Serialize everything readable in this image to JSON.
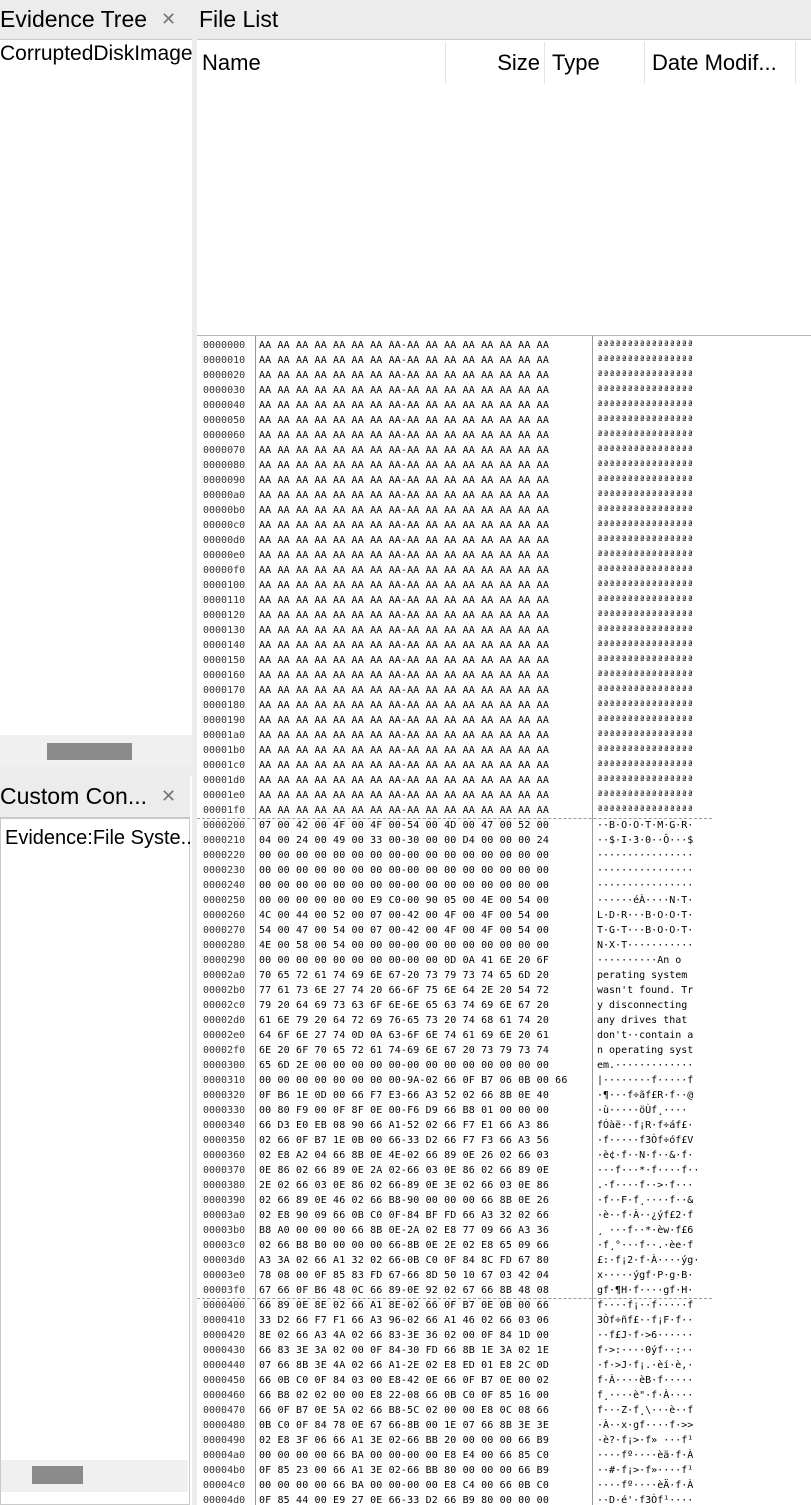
{
  "evidence_tree": {
    "title": "Evidence Tree",
    "items": [
      "CorruptedDiskImage"
    ]
  },
  "custom_content": {
    "title": "Custom Con...",
    "items": [
      "Evidence:File Syste..."
    ]
  },
  "file_list": {
    "title": "File List",
    "columns": [
      "Name",
      "Size",
      "Type",
      "Date Modif..."
    ]
  },
  "hex_view": {
    "rows": [
      [
        "0000000",
        "AA AA AA AA AA AA AA AA-AA AA AA AA AA AA AA AA",
        "ªªªªªªªªªªªªªªªª"
      ],
      [
        "0000010",
        "AA AA AA AA AA AA AA AA-AA AA AA AA AA AA AA AA",
        "ªªªªªªªªªªªªªªªª"
      ],
      [
        "0000020",
        "AA AA AA AA AA AA AA AA-AA AA AA AA AA AA AA AA",
        "ªªªªªªªªªªªªªªªª"
      ],
      [
        "0000030",
        "AA AA AA AA AA AA AA AA-AA AA AA AA AA AA AA AA",
        "ªªªªªªªªªªªªªªªª"
      ],
      [
        "0000040",
        "AA AA AA AA AA AA AA AA-AA AA AA AA AA AA AA AA",
        "ªªªªªªªªªªªªªªªª"
      ],
      [
        "0000050",
        "AA AA AA AA AA AA AA AA-AA AA AA AA AA AA AA AA",
        "ªªªªªªªªªªªªªªªª"
      ],
      [
        "0000060",
        "AA AA AA AA AA AA AA AA-AA AA AA AA AA AA AA AA",
        "ªªªªªªªªªªªªªªªª"
      ],
      [
        "0000070",
        "AA AA AA AA AA AA AA AA-AA AA AA AA AA AA AA AA",
        "ªªªªªªªªªªªªªªªª"
      ],
      [
        "0000080",
        "AA AA AA AA AA AA AA AA-AA AA AA AA AA AA AA AA",
        "ªªªªªªªªªªªªªªªª"
      ],
      [
        "0000090",
        "AA AA AA AA AA AA AA AA-AA AA AA AA AA AA AA AA",
        "ªªªªªªªªªªªªªªªª"
      ],
      [
        "00000a0",
        "AA AA AA AA AA AA AA AA-AA AA AA AA AA AA AA AA",
        "ªªªªªªªªªªªªªªªª"
      ],
      [
        "00000b0",
        "AA AA AA AA AA AA AA AA-AA AA AA AA AA AA AA AA",
        "ªªªªªªªªªªªªªªªª"
      ],
      [
        "00000c0",
        "AA AA AA AA AA AA AA AA-AA AA AA AA AA AA AA AA",
        "ªªªªªªªªªªªªªªªª"
      ],
      [
        "00000d0",
        "AA AA AA AA AA AA AA AA-AA AA AA AA AA AA AA AA",
        "ªªªªªªªªªªªªªªªª"
      ],
      [
        "00000e0",
        "AA AA AA AA AA AA AA AA-AA AA AA AA AA AA AA AA",
        "ªªªªªªªªªªªªªªªª"
      ],
      [
        "00000f0",
        "AA AA AA AA AA AA AA AA-AA AA AA AA AA AA AA AA",
        "ªªªªªªªªªªªªªªªª"
      ],
      [
        "0000100",
        "AA AA AA AA AA AA AA AA-AA AA AA AA AA AA AA AA",
        "ªªªªªªªªªªªªªªªª"
      ],
      [
        "0000110",
        "AA AA AA AA AA AA AA AA-AA AA AA AA AA AA AA AA",
        "ªªªªªªªªªªªªªªªª"
      ],
      [
        "0000120",
        "AA AA AA AA AA AA AA AA-AA AA AA AA AA AA AA AA",
        "ªªªªªªªªªªªªªªªª"
      ],
      [
        "0000130",
        "AA AA AA AA AA AA AA AA-AA AA AA AA AA AA AA AA",
        "ªªªªªªªªªªªªªªªª"
      ],
      [
        "0000140",
        "AA AA AA AA AA AA AA AA-AA AA AA AA AA AA AA AA",
        "ªªªªªªªªªªªªªªªª"
      ],
      [
        "0000150",
        "AA AA AA AA AA AA AA AA-AA AA AA AA AA AA AA AA",
        "ªªªªªªªªªªªªªªªª"
      ],
      [
        "0000160",
        "AA AA AA AA AA AA AA AA-AA AA AA AA AA AA AA AA",
        "ªªªªªªªªªªªªªªªª"
      ],
      [
        "0000170",
        "AA AA AA AA AA AA AA AA-AA AA AA AA AA AA AA AA",
        "ªªªªªªªªªªªªªªªª"
      ],
      [
        "0000180",
        "AA AA AA AA AA AA AA AA-AA AA AA AA AA AA AA AA",
        "ªªªªªªªªªªªªªªªª"
      ],
      [
        "0000190",
        "AA AA AA AA AA AA AA AA-AA AA AA AA AA AA AA AA",
        "ªªªªªªªªªªªªªªªª"
      ],
      [
        "00001a0",
        "AA AA AA AA AA AA AA AA-AA AA AA AA AA AA AA AA",
        "ªªªªªªªªªªªªªªªª"
      ],
      [
        "00001b0",
        "AA AA AA AA AA AA AA AA-AA AA AA AA AA AA AA AA",
        "ªªªªªªªªªªªªªªªª"
      ],
      [
        "00001c0",
        "AA AA AA AA AA AA AA AA-AA AA AA AA AA AA AA AA",
        "ªªªªªªªªªªªªªªªª"
      ],
      [
        "00001d0",
        "AA AA AA AA AA AA AA AA-AA AA AA AA AA AA AA AA",
        "ªªªªªªªªªªªªªªªª"
      ],
      [
        "00001e0",
        "AA AA AA AA AA AA AA AA-AA AA AA AA AA AA AA AA",
        "ªªªªªªªªªªªªªªªª"
      ],
      [
        "00001f0",
        "AA AA AA AA AA AA AA AA-AA AA AA AA AA AA AA AA",
        "ªªªªªªªªªªªªªªªª"
      ],
      [
        "0000200",
        "07 00 42 00 4F 00 4F 00-54 00 4D 00 47 00 52 00",
        "··B·O·O·T·M·G·R·"
      ],
      [
        "0000210",
        "04 00 24 00 49 00 33 00-30 00 00 D4 00 00 00 24",
        "··$·I·3·0··Ô···$"
      ],
      [
        "0000220",
        "00 00 00 00 00 00 00 00-00 00 00 00 00 00 00 00",
        "················"
      ],
      [
        "0000230",
        "00 00 00 00 00 00 00 00-00 00 00 00 00 00 00 00",
        "················"
      ],
      [
        "0000240",
        "00 00 00 00 00 00 00 00-00 00 00 00 00 00 00 00",
        "················"
      ],
      [
        "0000250",
        "00 00 00 00 00 00 E9 C0-00 90 05 00 4E 00 54 00",
        "······éÀ····N·T·"
      ],
      [
        "0000260",
        "4C 00 44 00 52 00 07 00-42 00 4F 00 4F 00 54 00",
        "L·D·R···B·O·O·T·"
      ],
      [
        "0000270",
        "54 00 47 00 54 00 07 00-42 00 4F 00 4F 00 54 00",
        "T·G·T···B·O·O·T·"
      ],
      [
        "0000280",
        "4E 00 58 00 54 00 00 00-00 00 00 00 00 00 00 00",
        "N·X·T···········"
      ],
      [
        "0000290",
        "00 00 00 00 00 00 00 00-00 00 0D 0A 41 6E 20 6F",
        "··········An o"
      ],
      [
        "00002a0",
        "70 65 72 61 74 69 6E 67-20 73 79 73 74 65 6D 20",
        "perating system "
      ],
      [
        "00002b0",
        "77 61 73 6E 27 74 20 66-6F 75 6E 64 2E 20 54 72",
        "wasn't found. Tr"
      ],
      [
        "00002c0",
        "79 20 64 69 73 63 6F 6E-6E 65 63 74 69 6E 67 20",
        "y disconnecting "
      ],
      [
        "00002d0",
        "61 6E 79 20 64 72 69 76-65 73 20 74 68 61 74 20",
        "any drives that "
      ],
      [
        "00002e0",
        "64 6F 6E 27 74 0D 0A 63-6F 6E 74 61 69 6E 20 61",
        "don't··contain a"
      ],
      [
        "00002f0",
        "6E 20 6F 70 65 72 61 74-69 6E 67 20 73 79 73 74",
        "n operating syst"
      ],
      [
        "0000300",
        "65 6D 2E 00 00 00 00 00-00 00 00 00 00 00 00 00",
        "em.·············"
      ],
      [
        "0000310",
        "00 00 00 00 00 00 00 00-9A-02 66 0F B7 06 0B 00 66",
        "|········f·····f"
      ],
      [
        "0000320",
        "0F B6 1E 0D 00 66 F7 E3-66 A3 52 02 66 8B 0E 40",
        "·¶···f÷ãf£R·f··@"
      ],
      [
        "0000330",
        "00 80 F9 00 0F 8F 0E 00-F6 D9 66 B8 01 00 00 00",
        "·ù·····öÙf¸····"
      ],
      [
        "0000340",
        "66 D3 E0 EB 08 90 66 A1-52 02 66 F7 E1 66 A3 86",
        "fÓàë··f¡R·f÷áf£·"
      ],
      [
        "0000350",
        "02 66 0F B7 1E 0B 00 66-33 D2 66 F7 F3 66 A3 56",
        "·f·····f3Òf÷óf£V"
      ],
      [
        "0000360",
        "02 E8 A2 04 66 8B 0E 4E-02 66 89 0E 26 02 66 03",
        "·è¢·f··N·f··&·f·"
      ],
      [
        "0000370",
        "0E 86 02 66 89 0E 2A 02-66 03 0E 86 02 66 89 0E",
        "···f···*·f····f··"
      ],
      [
        "0000380",
        "2E 02 66 03 0E 86 02 66-89 0E 3E 02 66 03 0E 86",
        ".·f····f··>·f···"
      ],
      [
        "0000390",
        "02 66 89 0E 46 02 66 B8-90 00 00 00 66 8B 0E 26",
        "·f··F·f¸····f··&"
      ],
      [
        "00003a0",
        "02 E8 90 09 66 0B C0 0F-84 BF FD 66 A3 32 02 66",
        "·è··f·À··¿ýf£2·f"
      ],
      [
        "00003b0",
        "B8 A0 00 00 00 66 8B 0E-2A 02 E8 77 09 66 A3 36",
        "¸ ···f··*·èw·f£6"
      ],
      [
        "00003c0",
        "02 66 B8 B0 00 00 00 66-8B 0E 2E 02 E8 65 09 66",
        "·f¸°···f··.·èe·f"
      ],
      [
        "00003d0",
        "A3 3A 02 66 A1 32 02 66-0B C0 0F 84 8C FD 67 80",
        "£:·f¡2·f·À····ýg·"
      ],
      [
        "00003e0",
        "78 08 00 0F 85 83 FD 67-66 8D 50 10 67 03 42 04",
        "x·····ýgf·P·g·B·"
      ],
      [
        "00003f0",
        "67 66 0F B6 48 0C 66 89-0E 92 02 67 66 8B 48 08",
        "gf·¶H·f····gf·H·"
      ],
      [
        "0000400",
        "66 89 0E 8E 02 66 A1 8E-02 66 0F B7 0E 0B 00 66",
        "f····f¡··f·····f"
      ],
      [
        "0000410",
        "33 D2 66 F7 F1 66 A3 96-02 66 A1 46 02 66 03 06",
        "3Òf÷ñf£··f¡F·f··"
      ],
      [
        "0000420",
        "8E 02 66 A3 4A 02 66 83-3E 36 02 00 0F 84 1D 00",
        "··f£J·f·>6······"
      ],
      [
        "0000430",
        "66 83 3E 3A 02 00 0F 84-30 FD 66 8B 1E 3A 02 1E",
        "f·>:····0ýf··:··"
      ],
      [
        "0000440",
        "07 66 8B 3E 4A 02 66 A1-2E 02 E8 ED 01 E8 2C 0D",
        "·f·>J·f¡.·èí·è,·"
      ],
      [
        "0000450",
        "66 0B C0 0F 84 03 00 E8-42 0E 66 0F B7 0E 00 02",
        "f·À····èB·f·····"
      ],
      [
        "0000460",
        "66 B8 02 02 00 00 E8 22-08 66 0B C0 0F 85 16 00",
        "f¸····è\"·f·À····"
      ],
      [
        "0000470",
        "66 0F B7 0E 5A 02 66 B8-5C 02 00 00 E8 0C 08 66",
        "f···Z·f¸\\···è··f"
      ],
      [
        "0000480",
        "0B C0 0F 84 78 0E 67 66-8B 00 1E 07 66 8B 3E 3E",
        "·À··x·gf····f·>>"
      ],
      [
        "0000490",
        "02 E8 3F 06 66 A1 3E 02-66 BB 20 00 00 00 66 B9",
        "·è?·f¡>·f» ···f¹"
      ],
      [
        "00004a0",
        "00 00 00 00 66 BA 00 00-00 00 E8 E4 00 66 85 C0",
        "····fº····èä·f·À"
      ],
      [
        "00004b0",
        "0F 85 23 00 66 A1 3E 02-66 BB 80 00 00 00 66 B9",
        "··#·f¡>·f»····f¹"
      ],
      [
        "00004c0",
        "00 00 00 00 66 BA 00 00-00 00 E8 C4 00 66 0B C0",
        "····fº····èÄ·f·À"
      ],
      [
        "00004d0",
        "0F 85 44 00 E9 27 0E 66-33 D2 66 B9 80 00 00 00",
        "··D·é'·f3Òf¹····"
      ]
    ]
  }
}
